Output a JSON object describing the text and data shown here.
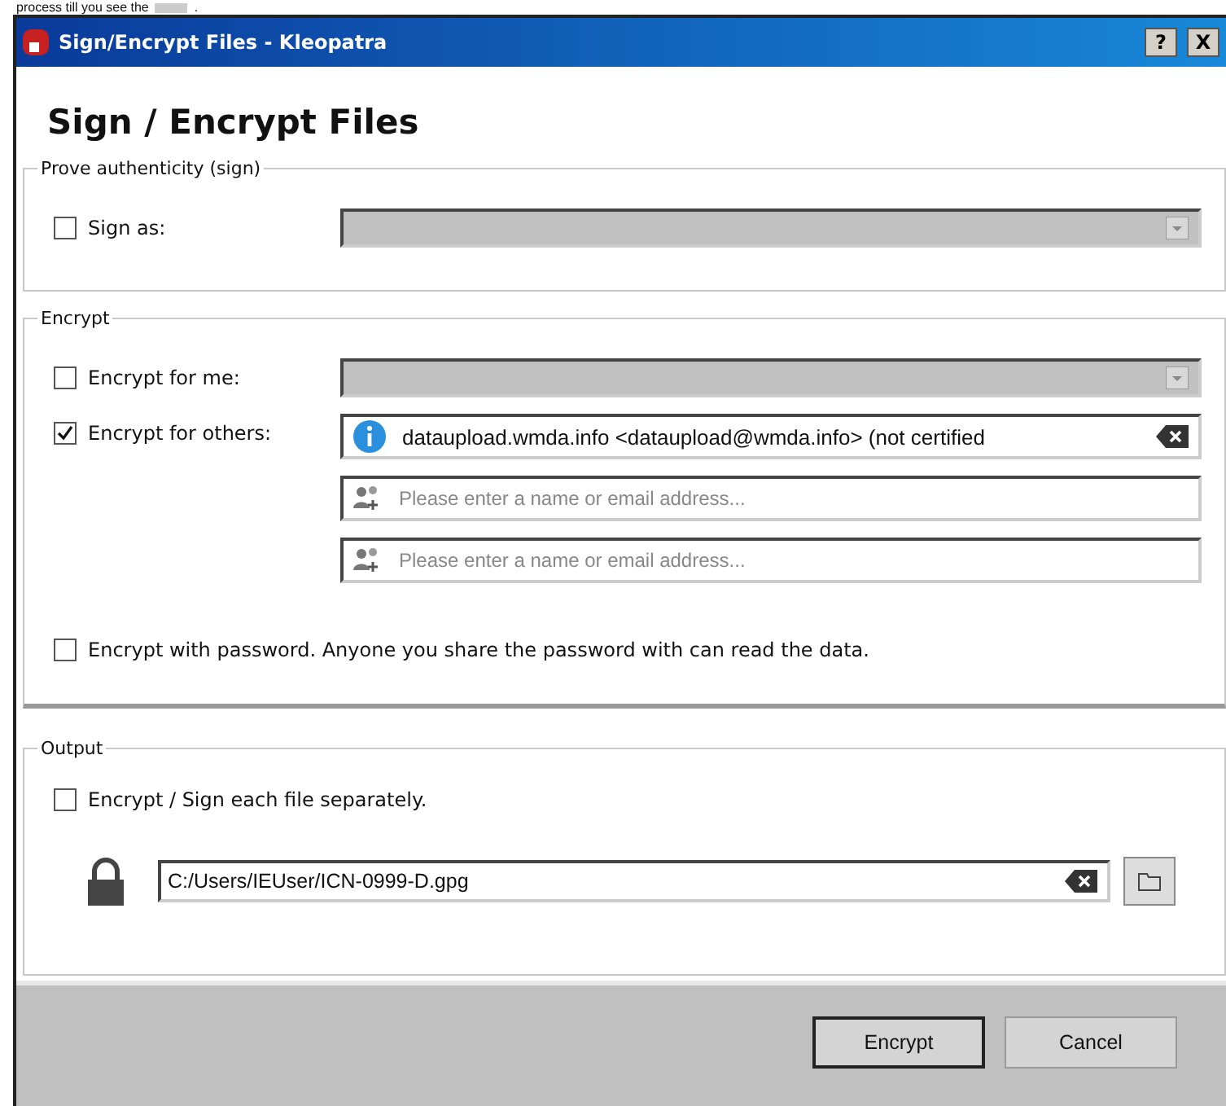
{
  "caption": {
    "before": "process till you see the",
    "after": "."
  },
  "window": {
    "title": "Sign/Encrypt Files - Kleopatra",
    "help": "?",
    "close": "X"
  },
  "heading": "Sign / Encrypt Files",
  "sign": {
    "title": "Prove authenticity (sign)",
    "sign_as": {
      "label": "Sign as:",
      "checked": false,
      "disabled": true
    }
  },
  "encrypt": {
    "title": "Encrypt",
    "for_me": {
      "label": "Encrypt for me:",
      "checked": false,
      "disabled": true
    },
    "for_others": {
      "label": "Encrypt for others:",
      "checked": true
    },
    "recipients": [
      {
        "kind": "certificate",
        "value": "dataupload.wmda.info <dataupload@wmda.info> (not certified"
      },
      {
        "kind": "empty",
        "placeholder": "Please enter a name or email address..."
      },
      {
        "kind": "empty",
        "placeholder": "Please enter a name or email address..."
      }
    ],
    "password": {
      "label": "Encrypt with password. Anyone you share the password with can read the data.",
      "checked": false
    }
  },
  "output": {
    "title": "Output",
    "separately": {
      "label": "Encrypt / Sign each file separately.",
      "checked": false
    },
    "path": "C:/Users/IEUser/ICN-0999-D.gpg"
  },
  "buttons": [
    {
      "label": "Encrypt",
      "default": true
    },
    {
      "label": "Cancel",
      "default": false
    }
  ]
}
